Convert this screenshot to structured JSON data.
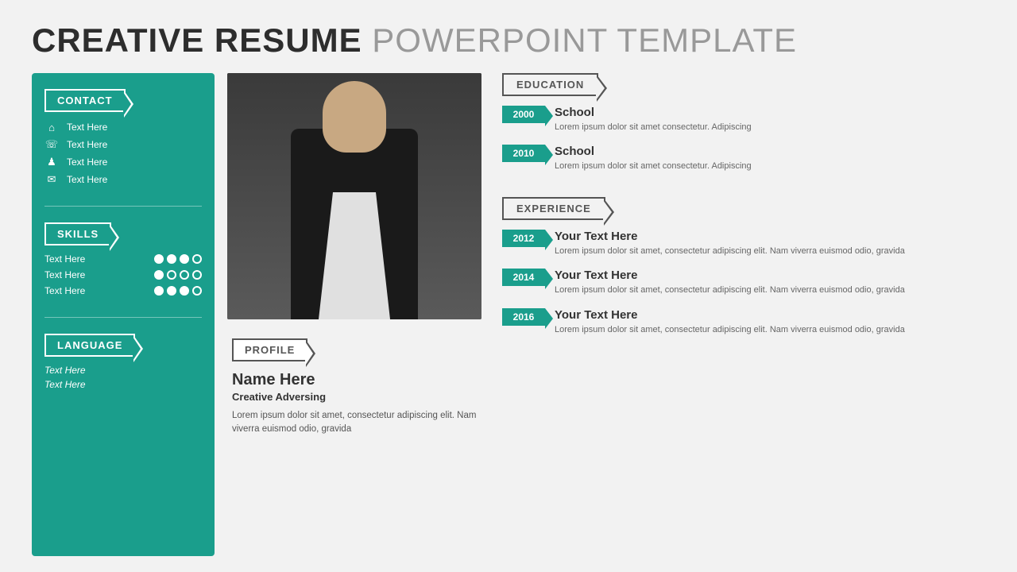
{
  "header": {
    "bold_part": "CREATIVE RESUME",
    "light_part": " POWERPOINT TEMPLATE"
  },
  "sidebar": {
    "contact_label": "CONTACT",
    "contact_items": [
      {
        "icon": "🏠",
        "text": "Text Here"
      },
      {
        "icon": "📞",
        "text": "Text Here"
      },
      {
        "icon": "👤",
        "text": "Text Here"
      },
      {
        "icon": "✉",
        "text": "Text Here"
      }
    ],
    "skills_label": "SKILLS",
    "skills": [
      {
        "name": "Text Here",
        "filled": 3,
        "empty": 1
      },
      {
        "name": "Text Here",
        "filled": 1,
        "empty": 3
      },
      {
        "name": "Text Here",
        "filled": 3,
        "empty": 1
      }
    ],
    "language_label": "LANGUAGE",
    "languages": [
      "Text Here",
      "Text Here"
    ]
  },
  "profile": {
    "section_label": "PROFILE",
    "name": "Name Here",
    "job_title": "Creative Adversing",
    "description": "Lorem ipsum dolor sit amet, consectetur adipiscing elit. Nam viverra euismod odio, gravida"
  },
  "education": {
    "label": "EDUCATION",
    "items": [
      {
        "year": "2000",
        "title": "School",
        "desc": "Lorem ipsum dolor sit amet consectetur. Adipiscing"
      },
      {
        "year": "2010",
        "title": "School",
        "desc": "Lorem ipsum dolor sit amet consectetur. Adipiscing"
      }
    ]
  },
  "experience": {
    "label": "EXPERIENCE",
    "items": [
      {
        "year": "2012",
        "title": "Your Text Here",
        "desc": "Lorem ipsum dolor sit amet, consectetur adipiscing elit. Nam viverra euismod odio, gravida"
      },
      {
        "year": "2014",
        "title": "Your Text Here",
        "desc": "Lorem ipsum dolor sit amet, consectetur adipiscing elit. Nam viverra euismod odio, gravida"
      },
      {
        "year": "2016",
        "title": "Your Text Here",
        "desc": "Lorem ipsum dolor sit amet, consectetur adipiscing elit. Nam viverra euismod odio, gravida"
      }
    ]
  },
  "colors": {
    "teal": "#1a9e8c",
    "dark_text": "#2d2d2d",
    "light_text": "#999999"
  }
}
